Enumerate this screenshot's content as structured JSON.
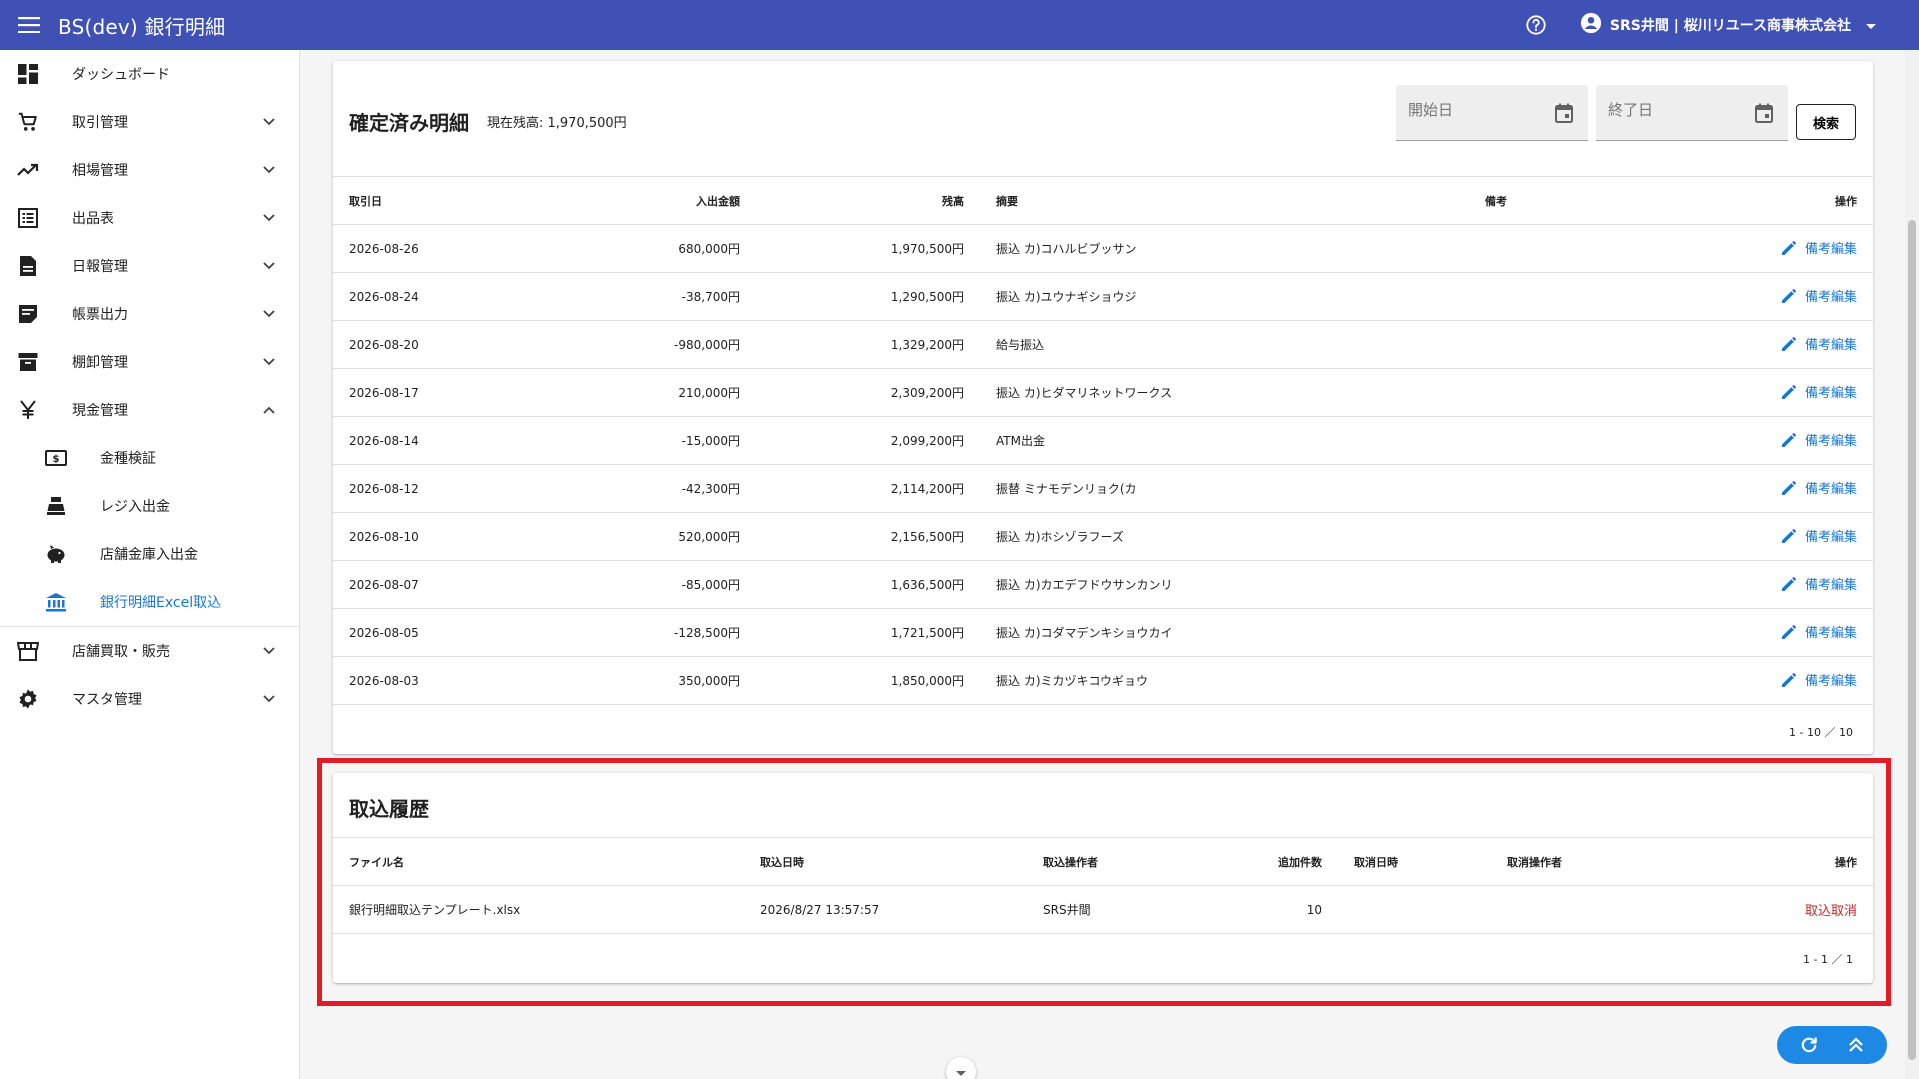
{
  "header": {
    "title": "BS(dev) 銀行明細",
    "user": "SRS井間 | 桜川リユース商事株式会社"
  },
  "sidebar": {
    "items": [
      {
        "label": "ダッシュボード"
      },
      {
        "label": "取引管理"
      },
      {
        "label": "相場管理"
      },
      {
        "label": "出品表"
      },
      {
        "label": "日報管理"
      },
      {
        "label": "帳票出力"
      },
      {
        "label": "棚卸管理"
      },
      {
        "label": "現金管理"
      },
      {
        "label": "金種検証"
      },
      {
        "label": "レジ入出金"
      },
      {
        "label": "店舗金庫入出金"
      },
      {
        "label": "銀行明細Excel取込"
      },
      {
        "label": "店舗買取・販売"
      },
      {
        "label": "マスタ管理"
      }
    ]
  },
  "statements": {
    "title": "確定済み明細",
    "balance": "現在残高: 1,970,500円",
    "start_placeholder": "開始日",
    "end_placeholder": "終了日",
    "search_label": "検索",
    "columns": [
      "取引日",
      "入出金額",
      "残高",
      "摘要",
      "備考",
      "操作"
    ],
    "edit_label": "備考編集",
    "rows": [
      {
        "date": "2026-08-26",
        "amount": "680,000円",
        "balance": "1,970,500円",
        "desc": "振込 カ)コハルビブッサン",
        "note": ""
      },
      {
        "date": "2026-08-24",
        "amount": "-38,700円",
        "balance": "1,290,500円",
        "desc": "振込 カ)ユウナギショウジ",
        "note": ""
      },
      {
        "date": "2026-08-20",
        "amount": "-980,000円",
        "balance": "1,329,200円",
        "desc": "給与振込",
        "note": ""
      },
      {
        "date": "2026-08-17",
        "amount": "210,000円",
        "balance": "2,309,200円",
        "desc": "振込 カ)ヒダマリネットワークス",
        "note": ""
      },
      {
        "date": "2026-08-14",
        "amount": "-15,000円",
        "balance": "2,099,200円",
        "desc": "ATM出金",
        "note": ""
      },
      {
        "date": "2026-08-12",
        "amount": "-42,300円",
        "balance": "2,114,200円",
        "desc": "振替 ミナモデンリョク(カ",
        "note": ""
      },
      {
        "date": "2026-08-10",
        "amount": "520,000円",
        "balance": "2,156,500円",
        "desc": "振込 カ)ホシゾラフーズ",
        "note": ""
      },
      {
        "date": "2026-08-07",
        "amount": "-85,000円",
        "balance": "1,636,500円",
        "desc": "振込 カ)カエデフドウサンカンリ",
        "note": ""
      },
      {
        "date": "2026-08-05",
        "amount": "-128,500円",
        "balance": "1,721,500円",
        "desc": "振込 カ)コダマデンキショウカイ",
        "note": ""
      },
      {
        "date": "2026-08-03",
        "amount": "350,000円",
        "balance": "1,850,000円",
        "desc": "振込 カ)ミカヅキコウギョウ",
        "note": ""
      }
    ],
    "pagination": "1 - 10 ／ 10"
  },
  "history": {
    "title": "取込履歴",
    "columns": [
      "ファイル名",
      "取込日時",
      "取込操作者",
      "追加件数",
      "取消日時",
      "取消操作者",
      "操作"
    ],
    "rows": [
      {
        "file": "銀行明細取込テンプレート.xlsx",
        "imported_at": "2026/8/27 13:57:57",
        "operator": "SRS井間",
        "count": "10",
        "canceled_at": "",
        "canceler": "",
        "action": "取込取消"
      }
    ],
    "pagination": "1 - 1 ／ 1"
  },
  "colors": {
    "appbar": "#3f51b5",
    "link": "#1976d2",
    "danger": "#c62828",
    "highlight": "#e31b23"
  }
}
